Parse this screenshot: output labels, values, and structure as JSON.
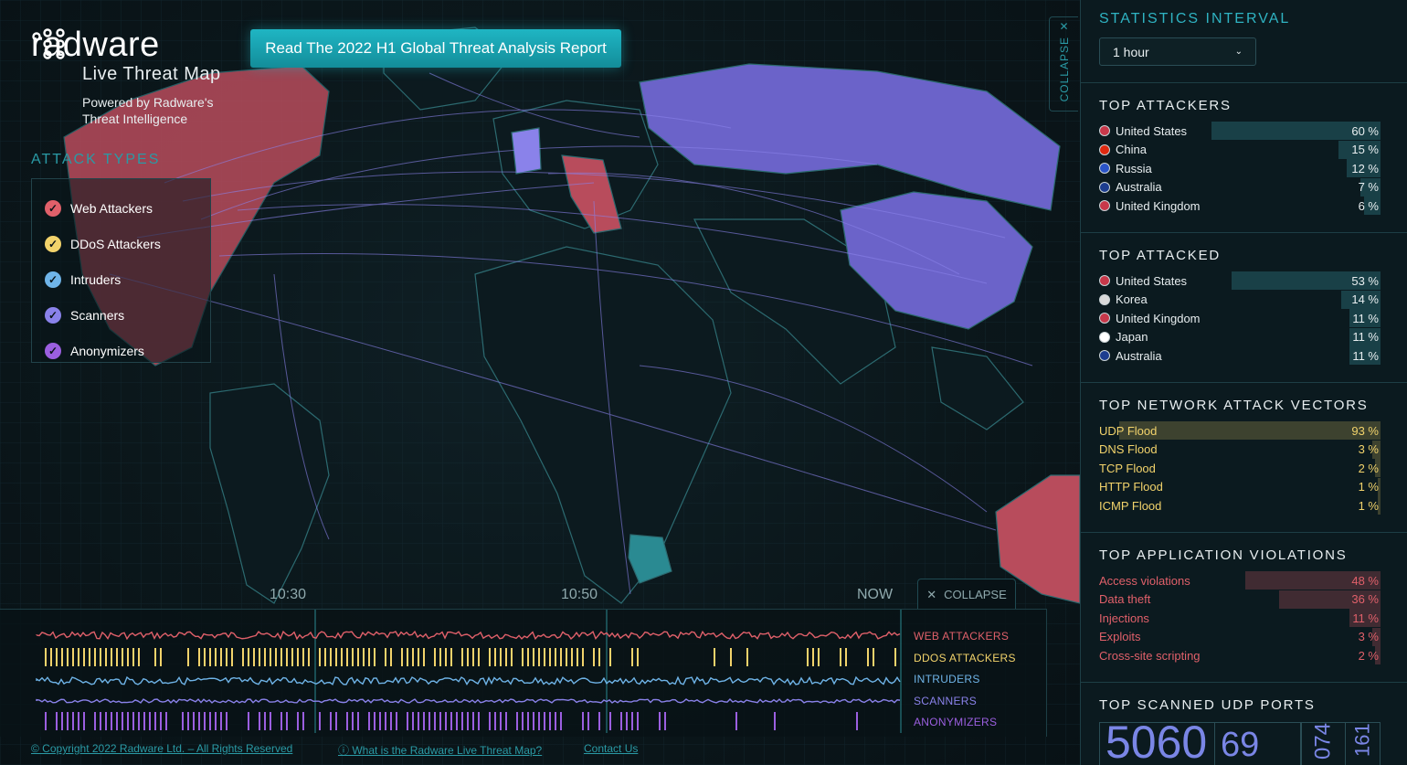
{
  "brand": {
    "name": "radware",
    "subtitle": "Live Threat Map",
    "powered_line1": "Powered by Radware's",
    "powered_line2": "Threat Intelligence"
  },
  "report_button": "Read The 2022 H1 Global Threat Analysis Report",
  "attack_types": {
    "title": "ATTACK TYPES",
    "items": [
      {
        "label": "Web Attackers",
        "color": "#e0606a"
      },
      {
        "label": "DDoS Attackers",
        "color": "#f2d36b"
      },
      {
        "label": "Intruders",
        "color": "#6fb4e8"
      },
      {
        "label": "Scanners",
        "color": "#8a82ea"
      },
      {
        "label": "Anonymizers",
        "color": "#9b5fe0"
      }
    ]
  },
  "map_collapse": {
    "label": "COLLAPSE",
    "icon": "close-icon"
  },
  "timeline": {
    "times": [
      "10:30",
      "10:50",
      "NOW"
    ],
    "collapse_label": "COLLAPSE",
    "legend": [
      {
        "label": "WEB ATTACKERS",
        "color": "#e0606a"
      },
      {
        "label": "DDOS ATTACKERS",
        "color": "#f2d36b"
      },
      {
        "label": "INTRUDERS",
        "color": "#6fb4e8"
      },
      {
        "label": "SCANNERS",
        "color": "#8a82ea"
      },
      {
        "label": "ANONYMIZERS",
        "color": "#9b5fe0"
      }
    ]
  },
  "footer": {
    "copyright": "© Copyright 2022 Radware Ltd. – All Rights Reserved",
    "what_is": "ⓘ What is the Radware Live Threat Map?",
    "contact": "Contact Us"
  },
  "sidebar": {
    "interval_title": "STATISTICS INTERVAL",
    "interval_value": "1 hour",
    "top_attackers": {
      "title": "TOP ATTACKERS",
      "rows": [
        {
          "name": "United States",
          "pct": "60 %",
          "value": 60,
          "flag": "#c8384a"
        },
        {
          "name": "China",
          "pct": "15 %",
          "value": 15,
          "flag": "#de2910"
        },
        {
          "name": "Russia",
          "pct": "12 %",
          "value": 12,
          "flag": "#2a54c8"
        },
        {
          "name": "Australia",
          "pct": "7 %",
          "value": 7,
          "flag": "#1d3d8f"
        },
        {
          "name": "United Kingdom",
          "pct": "6 %",
          "value": 6,
          "flag": "#c8384a"
        }
      ]
    },
    "top_attacked": {
      "title": "TOP ATTACKED",
      "rows": [
        {
          "name": "United States",
          "pct": "53 %",
          "value": 53,
          "flag": "#c8384a"
        },
        {
          "name": "Korea",
          "pct": "14 %",
          "value": 14,
          "flag": "#d9d9d9"
        },
        {
          "name": "United Kingdom",
          "pct": "11 %",
          "value": 11,
          "flag": "#c8384a"
        },
        {
          "name": "Japan",
          "pct": "11 %",
          "value": 11,
          "flag": "#ffffff"
        },
        {
          "name": "Australia",
          "pct": "11 %",
          "value": 11,
          "flag": "#1d3d8f"
        }
      ]
    },
    "network_vectors": {
      "title": "TOP NETWORK ATTACK VECTORS",
      "color": "#f2d36b",
      "rows": [
        {
          "name": "UDP Flood",
          "pct": "93 %",
          "value": 93
        },
        {
          "name": "DNS Flood",
          "pct": "3 %",
          "value": 3
        },
        {
          "name": "TCP Flood",
          "pct": "2 %",
          "value": 2
        },
        {
          "name": "HTTP Flood",
          "pct": "1 %",
          "value": 1
        },
        {
          "name": "ICMP Flood",
          "pct": "1 %",
          "value": 1
        }
      ]
    },
    "app_violations": {
      "title": "TOP APPLICATION VIOLATIONS",
      "color": "#e0606a",
      "rows": [
        {
          "name": "Access violations",
          "pct": "48 %",
          "value": 48
        },
        {
          "name": "Data theft",
          "pct": "36 %",
          "value": 36
        },
        {
          "name": "Injections",
          "pct": "11 %",
          "value": 11
        },
        {
          "name": "Exploits",
          "pct": "3 %",
          "value": 3
        },
        {
          "name": "Cross-site scripting",
          "pct": "2 %",
          "value": 2
        }
      ]
    },
    "udp_ports": {
      "title": "TOP SCANNED UDP PORTS",
      "ports": [
        "5060",
        "69",
        "074",
        "161"
      ]
    }
  }
}
